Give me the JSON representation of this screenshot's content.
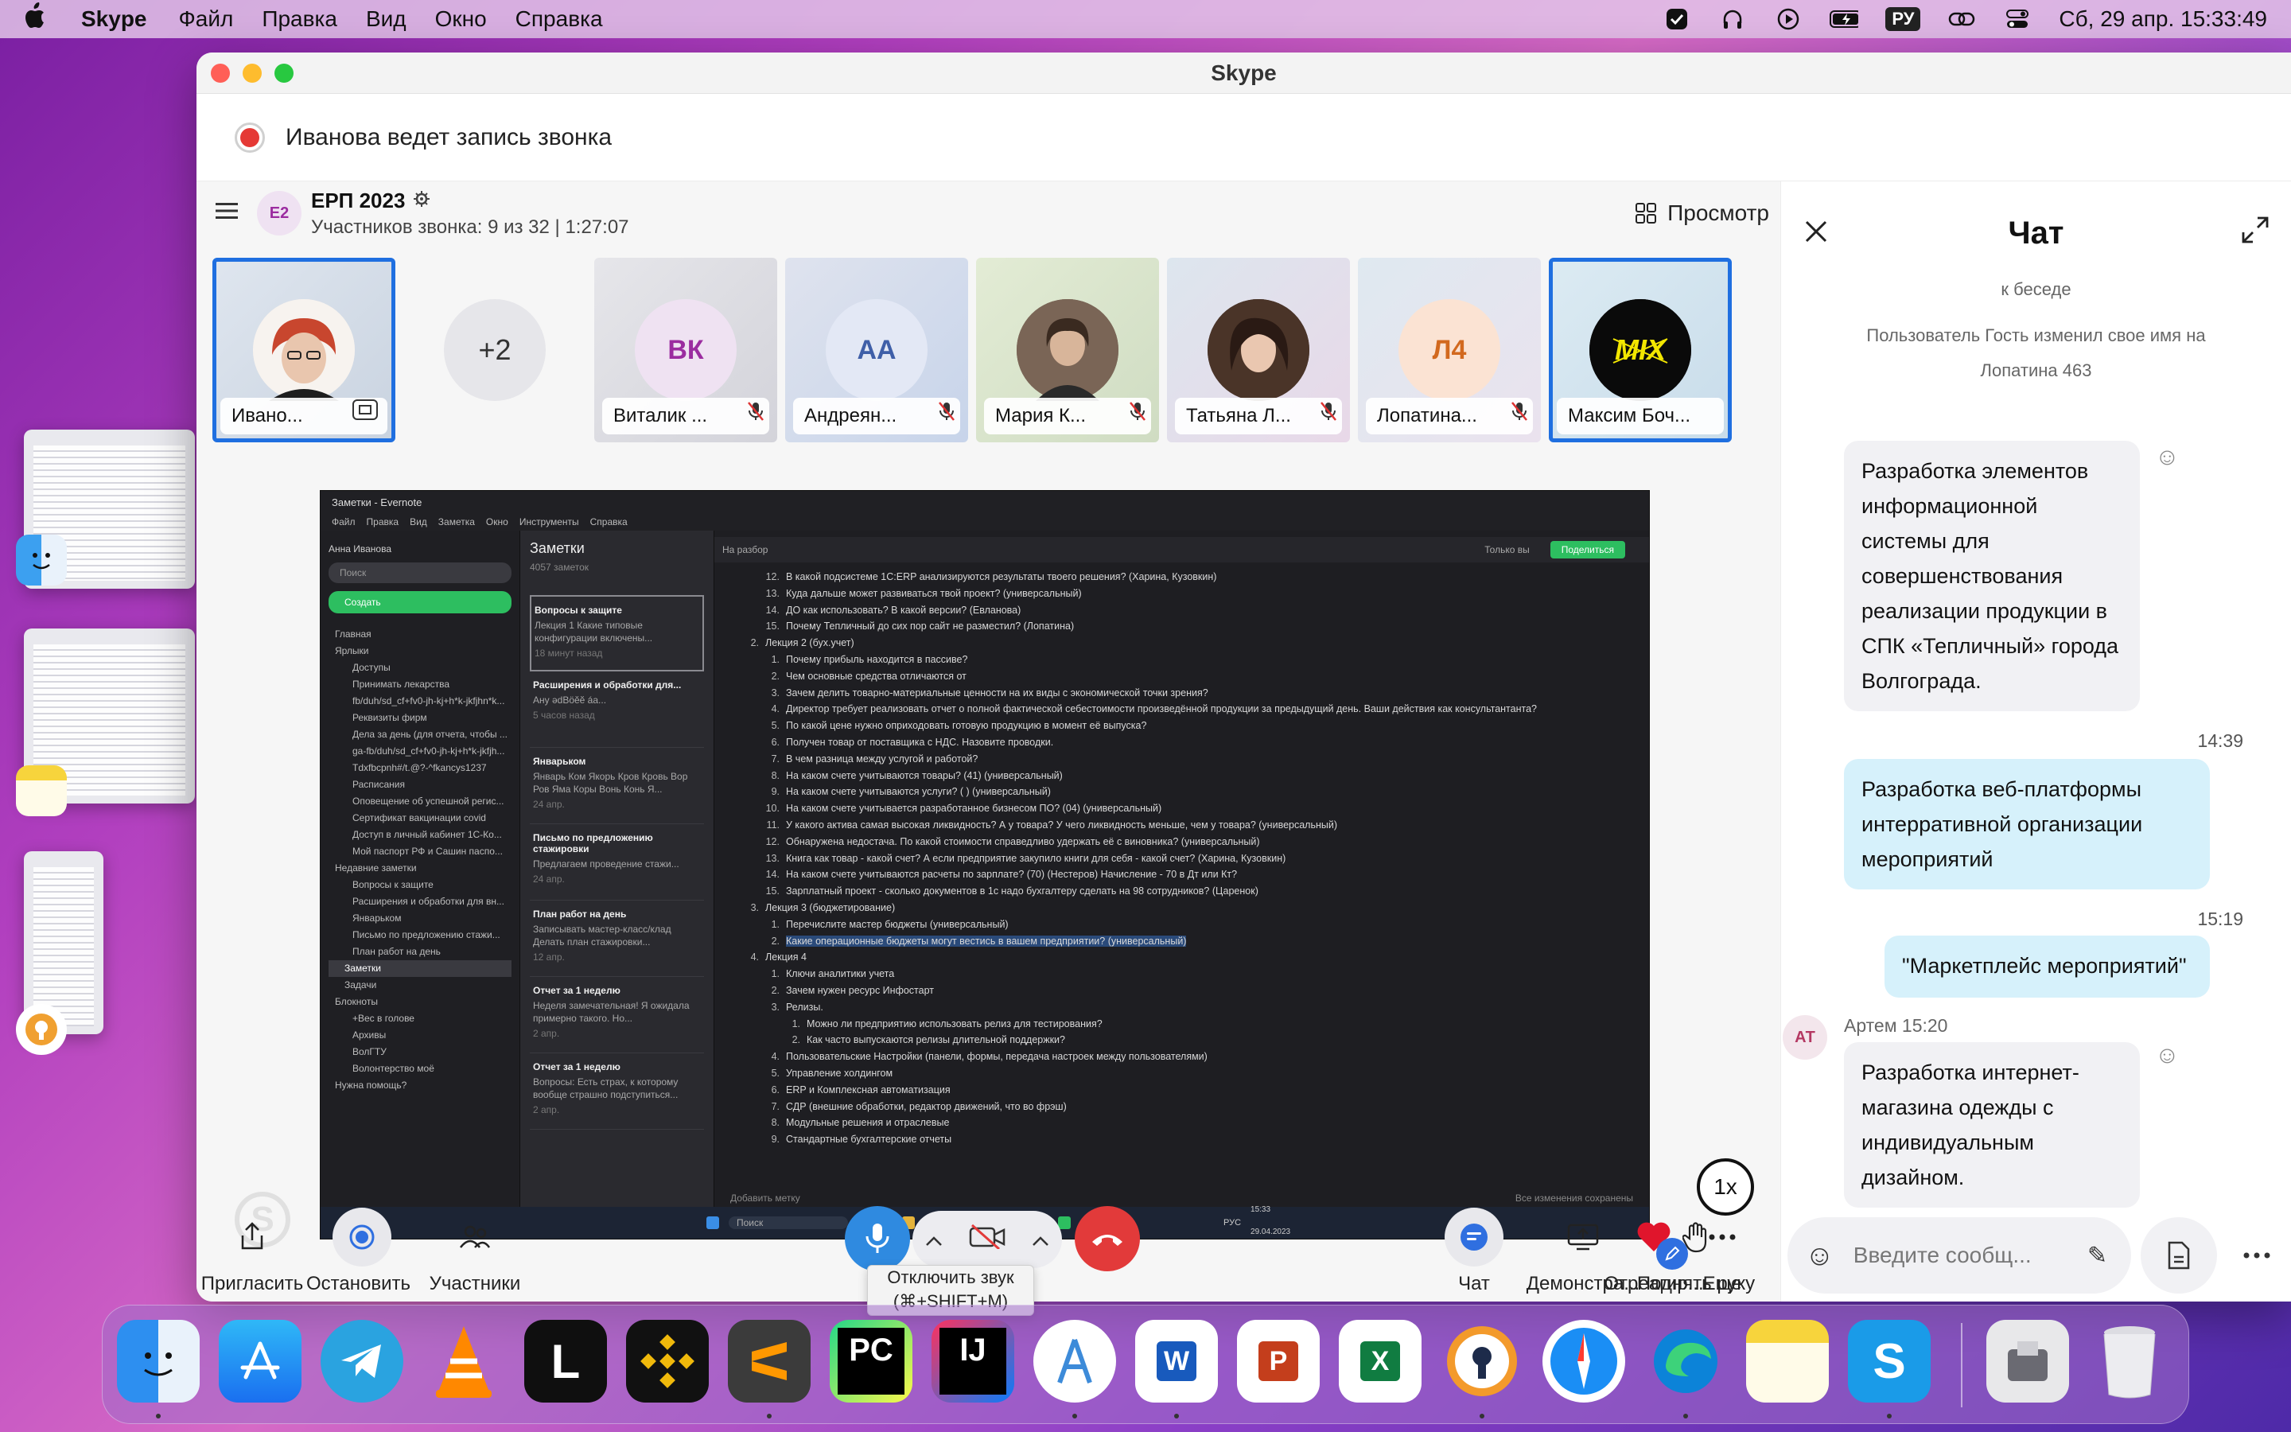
{
  "menubar": {
    "app_name": "Skype",
    "menus": [
      "Файл",
      "Правка",
      "Вид",
      "Окно",
      "Справка"
    ],
    "input_lang": "РУ",
    "datetime": "Сб, 29 апр.  15:33:49"
  },
  "window": {
    "title": "Skype",
    "recording_notice": "Иванова ведет запись звонка"
  },
  "call": {
    "group_badge": "E2",
    "group_name": "ЕРП 2023",
    "participants_info": "Участников звонка: 9 из 32 | 1:27:07",
    "view_label": "Просмотр",
    "overflow_count": "+2",
    "tiles": [
      {
        "name": "Ивано...",
        "initials": "",
        "muted": false
      },
      {
        "name": "Виталик ...",
        "initials": "ВК",
        "muted": true
      },
      {
        "name": "Андреян...",
        "initials": "АА",
        "muted": true
      },
      {
        "name": "Мария К...",
        "initials": "",
        "muted": true
      },
      {
        "name": "Татьяна Л...",
        "initials": "",
        "muted": true
      },
      {
        "name": "Лопатина...",
        "initials": "Л4",
        "muted": true
      },
      {
        "name": "Максим Боч...",
        "initials": "",
        "muted": false
      }
    ],
    "speed_label": "1x"
  },
  "shared_screen": {
    "window_title": "Заметки - Evernote",
    "menu": [
      "Файл",
      "Правка",
      "Вид",
      "Заметка",
      "Окно",
      "Инструменты",
      "Справка"
    ],
    "user": "Анна Иванова",
    "search_placeholder": "Поиск",
    "create_label": "Создать",
    "sidebar": [
      "Главная",
      "Ярлыки",
      "Доступы",
      "Принимать лекарства",
      "fb/duh/sd_cf+fv0-jh-kj+h*k-jkfjhn*k...",
      "Реквизиты фирм",
      "Дела за день (для отчета, чтобы ...",
      "ga-fb/duh/sd_cf+fv0-jh-kj+h*k-jkfjh...",
      "Tdxfbcpnh#/t.@?-^fkancys1237",
      "Расписания",
      "Оповещение об успешной регис...",
      "Сертификат вакцинации covid",
      "Доступ в личный кабинет 1С-Ко...",
      "Мой паспорт РФ и Сашин паспо...",
      "Недавние заметки",
      "Вопросы к защите",
      "Расширения и обработки для вн...",
      "Январьком",
      "Письмо по предложению стажи...",
      "План работ на день",
      "Заметки",
      "Задачи",
      "Блокноты",
      "+Вес в голове",
      "Архивы",
      "ВолГТУ",
      "Волонтерство моё",
      "Нужна помощь?"
    ],
    "list_title": "Заметки",
    "list_count": "4057 заметок",
    "cards": [
      {
        "title": "Вопросы к защите",
        "text": "Лекция 1 Какие типовые конфигурации включены...",
        "time": "18 минут назад"
      },
      {
        "title": "Расширения и обработки для...",
        "text": "Ану әdBӧӗӗ áa...",
        "time": "5 часов назад"
      },
      {
        "title": "Январьком",
        "text": "Январь Ком Якорь Кров Кровь Вор Ров Яма Коры Вонь Конь Я...",
        "time": "24 апр."
      },
      {
        "title": "Письмо по предложению стажировки",
        "text": "Предлагаем проведение стажи...",
        "time": "24 апр."
      },
      {
        "title": "План работ на день",
        "text": "Записывать мастер-класс/клад Делать план стажировки...",
        "time": "12 апр."
      },
      {
        "title": "Отчет за 1 неделю",
        "text": "Неделя замечательная! Я ожидала примерно такого. Но...",
        "time": "2 апр."
      },
      {
        "title": "Отчет за 1 неделю",
        "text": "Вопросы: Есть страх, к которому вообще страшно подступиться...",
        "time": "2 апр."
      }
    ],
    "note_breadcrumb": "На разбор",
    "note_access": "Только вы",
    "note_share": "Поделиться",
    "note_rows": [
      {
        "n": "12.",
        "t": "В какой подсистеме 1С:ERP анализируются результаты твоего решения? (Харина, Кузовкин)",
        "lvl": "l2"
      },
      {
        "n": "13.",
        "t": "Куда дальше может развиваться твой проект? (универсальный)",
        "lvl": "l2"
      },
      {
        "n": "14.",
        "t": "ДО как использовать? В какой версии? (Евланова)",
        "lvl": "l2"
      },
      {
        "n": "15.",
        "t": "Почему Тепличный до сих пор сайт не разместил? (Лопатина)",
        "lvl": "l2"
      },
      {
        "n": "2.",
        "t": "Лекция 2 (бух.учет)",
        "lvl": "l1"
      },
      {
        "n": "1.",
        "t": "Почему прибыль находится в пассиве?",
        "lvl": "l2"
      },
      {
        "n": "2.",
        "t": "Чем основные средства отличаются от",
        "lvl": "l2"
      },
      {
        "n": "3.",
        "t": "Зачем делить товарно-материальные ценности на их виды с экономической точки зрения?",
        "lvl": "l2"
      },
      {
        "n": "4.",
        "t": "Директор требует реализовать отчет  о полной фактической себестоимости произведённой продукции за предыдущий день. Ваши действия как консультантанта?",
        "lvl": "l2"
      },
      {
        "n": "5.",
        "t": "По какой цене нужно оприходовать готовую продукцию в момент её выпуска?",
        "lvl": "l2"
      },
      {
        "n": "6.",
        "t": "Получен товар от поставщика с НДС. Назовите проводки.",
        "lvl": "l2"
      },
      {
        "n": "7.",
        "t": "В чем разница между услугой и работой?",
        "lvl": "l2"
      },
      {
        "n": "8.",
        "t": "На каком счете учитываются товары? (41)  (универсальный)",
        "lvl": "l2"
      },
      {
        "n": "9.",
        "t": "На каком счете учитываются услуги? ( ) (универсальный)",
        "lvl": "l2"
      },
      {
        "n": "10.",
        "t": "На каком счете учитывается разработанное бизнесом ПО? (04)  (универсальный)",
        "lvl": "l2"
      },
      {
        "n": "11.",
        "t": "У какого актива самая высокая ликвидность? А у товара? У чего ликвидность меньше, чем у товара?  (универсальный)",
        "lvl": "l2"
      },
      {
        "n": "12.",
        "t": "Обнаружена недостача. По какой стоимости справедливо удержать её с виновника? (универсальный)",
        "lvl": "l2"
      },
      {
        "n": "13.",
        "t": "Книга как товар - какой счет? А если предприятие закупило книги для себя - какой счет? (Харина, Кузовкин)",
        "lvl": "l2"
      },
      {
        "n": "14.",
        "t": "На каком счете учитываются расчеты по зарплате? (70) (Нестеров) Начисление - 70 в Дт или Кт?",
        "lvl": "l2"
      },
      {
        "n": "15.",
        "t": "Зарплатный проект - сколько документов  в 1с надо бухгалтеру сделать на 98 сотрудников? (Царенок)",
        "lvl": "l2"
      },
      {
        "n": "3.",
        "t": "Лекция 3 (бюджетирование)",
        "lvl": "l1"
      },
      {
        "n": "1.",
        "t": "Перечислите мастер бюджеты (универсальный)",
        "lvl": "l2"
      },
      {
        "n": "2.",
        "t": "Какие операционные бюджеты могут вестись в вашем предприятии? (универсальный)",
        "lvl": "l2",
        "hl": true
      },
      {
        "n": "4.",
        "t": "Лекция 4",
        "lvl": "l1"
      },
      {
        "n": "1.",
        "t": "Ключи аналитики учета",
        "lvl": "l2"
      },
      {
        "n": "2.",
        "t": "Зачем нужен ресурс Инфостарт",
        "lvl": "l2"
      },
      {
        "n": "3.",
        "t": "Релизы.",
        "lvl": "l2"
      },
      {
        "n": "1.",
        "t": "Можно ли предприятию использовать релиз для тестирования?",
        "lvl": "l3"
      },
      {
        "n": "2.",
        "t": "Как часто выпускаются релизы длительной поддержки?",
        "lvl": "l3"
      },
      {
        "n": "4.",
        "t": "Пользовательские Настройки (панели, формы, передача настроек между пользователями)",
        "lvl": "l2"
      },
      {
        "n": "5.",
        "t": "Управление холдингом",
        "lvl": "l2"
      },
      {
        "n": "6.",
        "t": "ERP и Комплексная автоматизация",
        "lvl": "l2"
      },
      {
        "n": "7.",
        "t": "СДР (внешние обработки, редактор движений, что во фрэш)",
        "lvl": "l2"
      },
      {
        "n": "8.",
        "t": "Модульные решения и отраслевые",
        "lvl": "l2"
      },
      {
        "n": "9.",
        "t": "Стандартные бухгалтерские отчеты",
        "lvl": "l2"
      }
    ],
    "add_tag": "Добавить метку",
    "saved_status": "Все изменения сохранены",
    "taskbar_search": "Поиск",
    "taskbar_lang": "РУС",
    "taskbar_time": "15:33",
    "taskbar_date": "29.04.2023"
  },
  "controls": {
    "invite": "Пригласить",
    "stop": "Остановить ...",
    "participants": "Участники",
    "chat": "Чат",
    "share": "Демонстра...",
    "raise_hand": "Поднять руку",
    "react": "Отреагир...",
    "more": "Еще",
    "tooltip_line1": "Отключить звук",
    "tooltip_line2": "(⌘+SHIFT+M)"
  },
  "chat": {
    "title": "Чат",
    "sys_context": "к беседе",
    "sys_rename": "Пользователь Гость изменил свое имя на Лопатина 463",
    "msg1": "Разработка элементов информационной системы для совершенствования реализации продукции в СПК «Тепличный» города Волгограда.",
    "time1": "14:39",
    "msg2": "Разработка веб-платформы интерративной организации мероприятий",
    "time2": "15:19",
    "msg3": "\"Маркетплейс мероприятий\"",
    "sender_initials": "АТ",
    "sender_line": "Артем 15:20",
    "msg4": "Разработка интернет-магазина одежды с индивидуальным дизайном.",
    "input_placeholder": "Введите сообщ..."
  },
  "colors": {
    "accent_blue": "#2f8ae0",
    "end_call_red": "#e23a3a",
    "outgoing_bubble": "#d6f1fb",
    "recording_red": "#e53935"
  }
}
